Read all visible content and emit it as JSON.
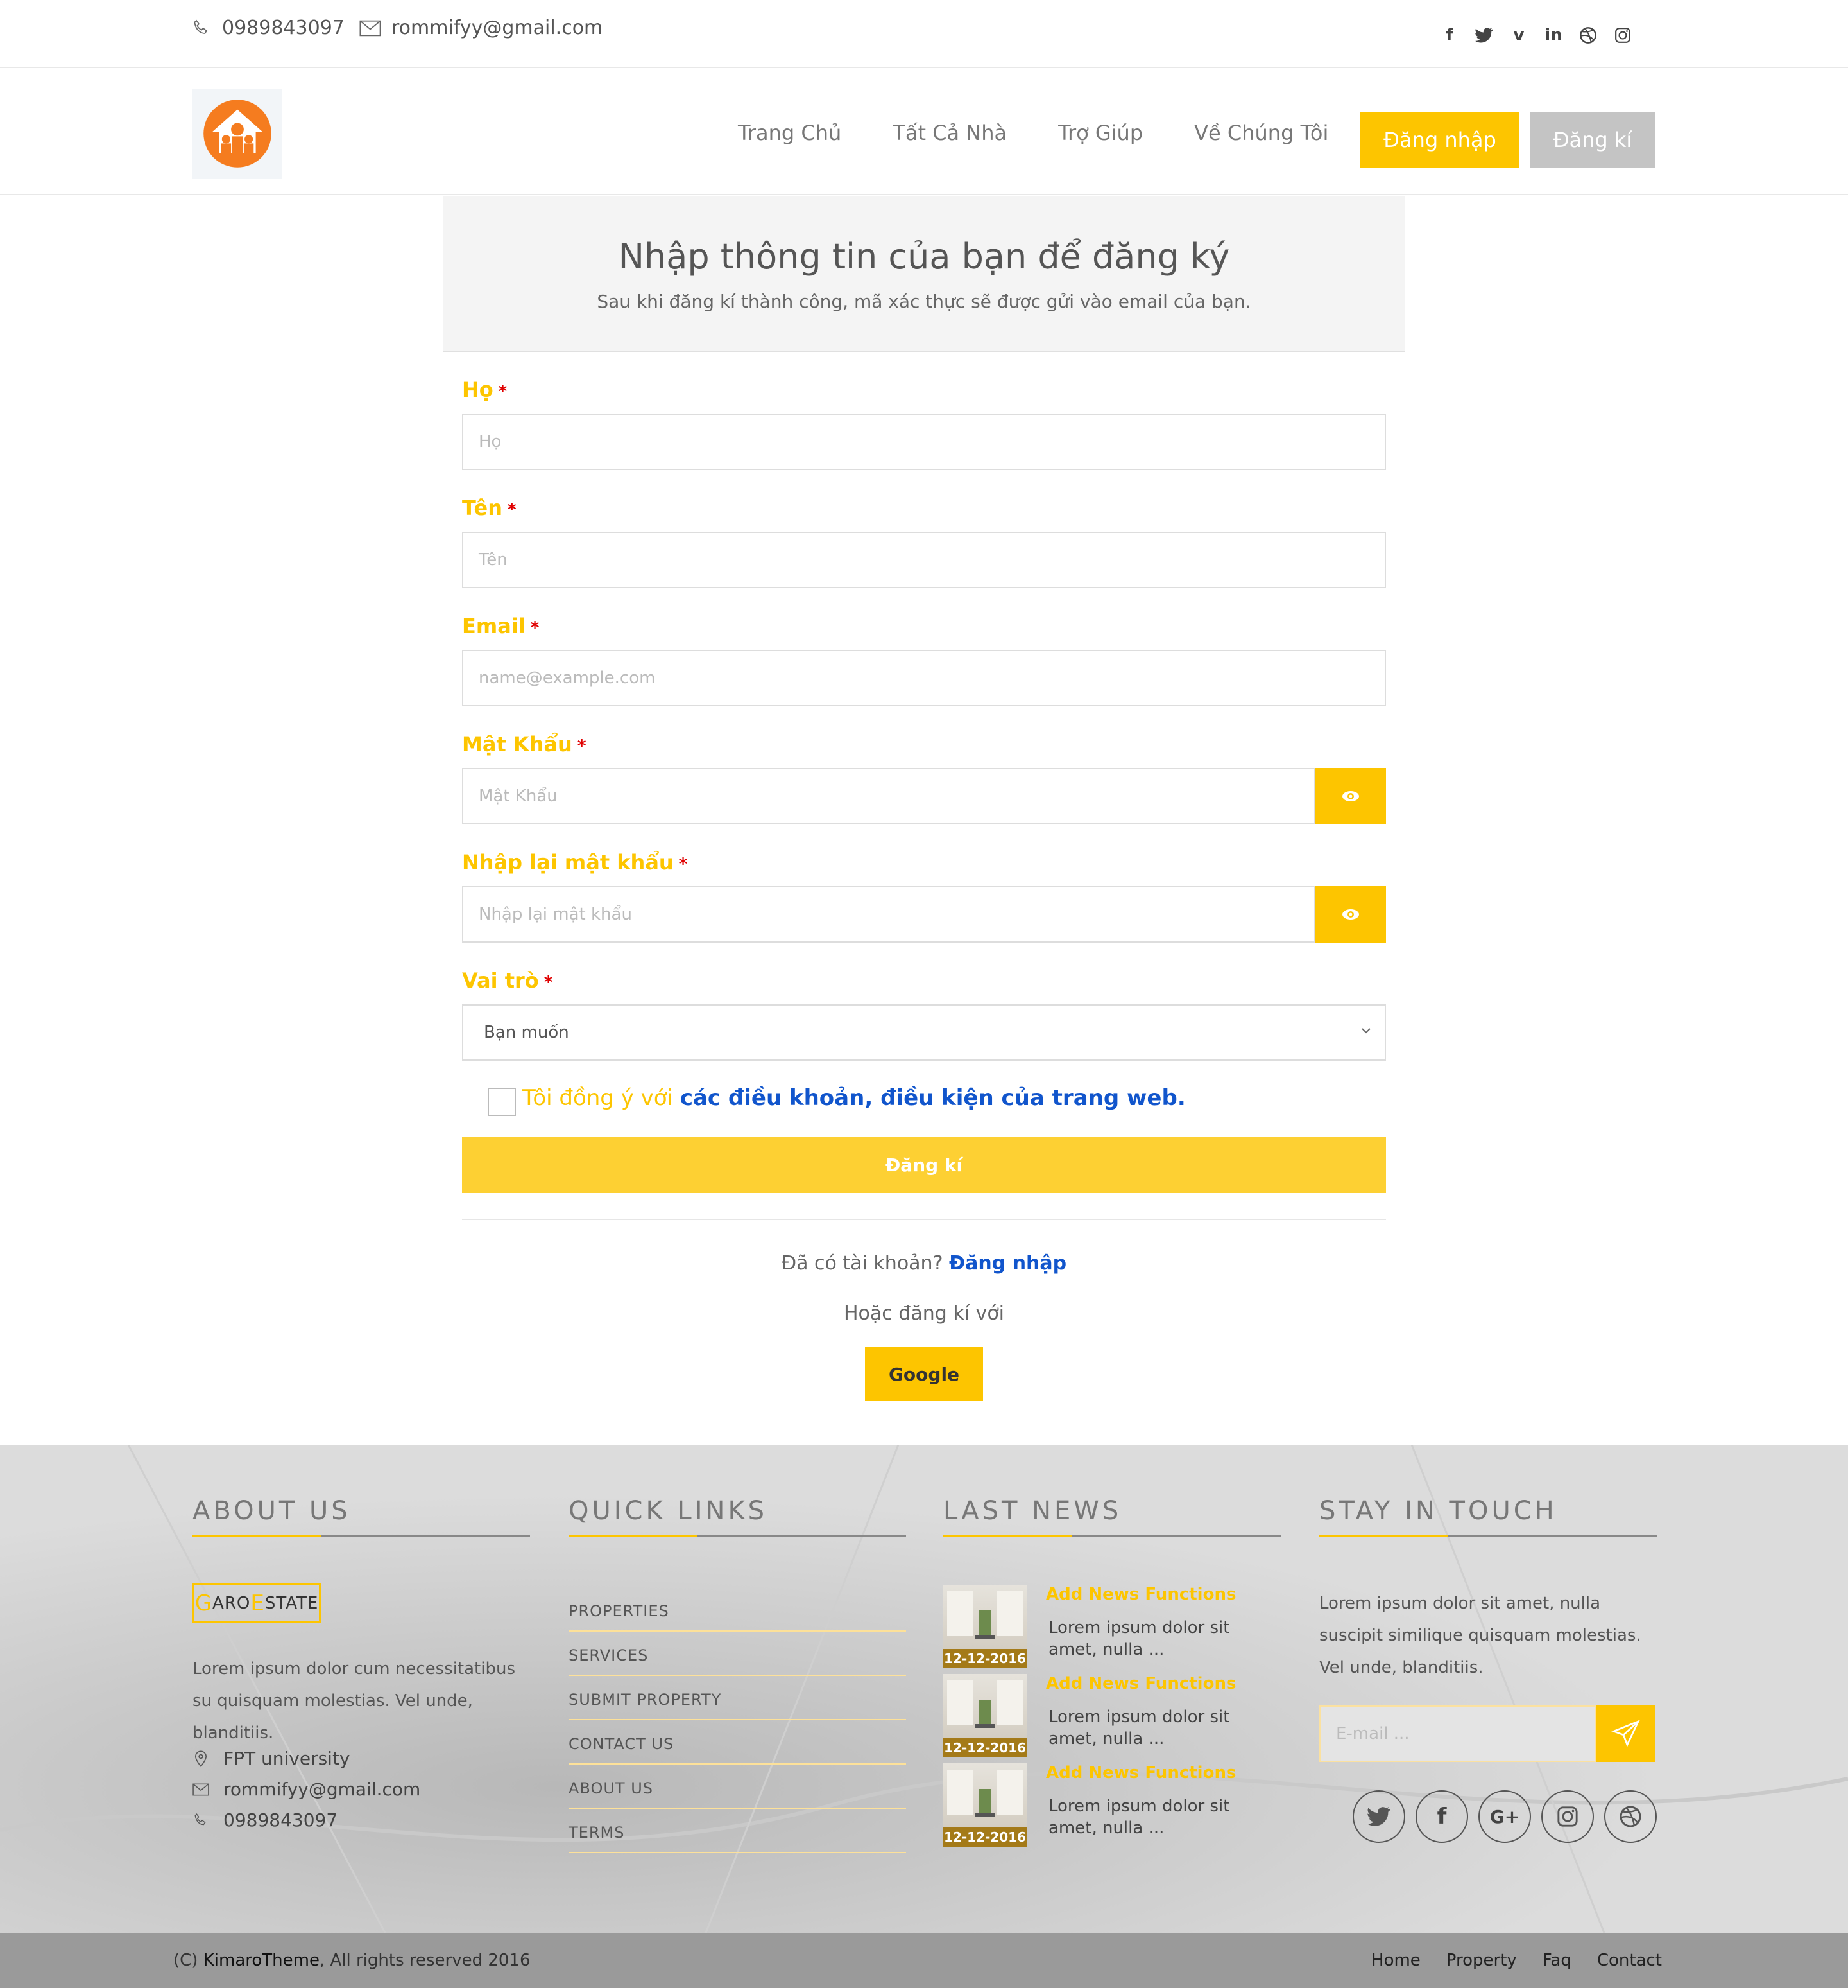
{
  "topbar": {
    "phone": "0989843097",
    "email": "rommifyy@gmail.com",
    "social_icons": [
      "facebook-icon",
      "twitter-icon",
      "vine-icon",
      "linkedin-icon",
      "dribbble-icon",
      "instagram-icon"
    ]
  },
  "nav": {
    "links": [
      "Trang Chủ",
      "Tất Cả Nhà",
      "Trợ Giúp",
      "Về Chúng Tôi"
    ],
    "login": "Đăng nhập",
    "register": "Đăng kí",
    "accent": "#fdc500"
  },
  "form": {
    "title": "Nhập thông tin của bạn để đăng ký",
    "subtitle": "Sau khi đăng kí thành công, mã xác thực sẽ được gửi vào email của bạn.",
    "fields": [
      {
        "label": "Họ",
        "placeholder": "Họ"
      },
      {
        "label": "Tên",
        "placeholder": "Tên"
      },
      {
        "label": "Email",
        "placeholder": "name@example.com"
      },
      {
        "label": "Mật Khẩu",
        "placeholder": "Mật Khẩu"
      },
      {
        "label": "Nhập lại mật khẩu",
        "placeholder": "Nhập lại mật khẩu"
      },
      {
        "label": "Vai trò",
        "placeholder": "Bạn muốn"
      }
    ],
    "required_mark": "*",
    "agree_prefix": "Tôi đồng ý với",
    "agree_link": "các điều khoản, điều kiện của trang web.",
    "submit": "Đăng kí",
    "have_account": "Đã có tài khoản?",
    "login_link": "Đăng nhập",
    "or_text": "Hoặc đăng kí với",
    "google": "Google"
  },
  "footer": {
    "about": {
      "title": "ABOUT US",
      "logo_first": "G",
      "logo_mid": "ARO ",
      "logo_e": "E",
      "logo_rest": "STATE",
      "text": "Lorem ipsum dolor cum necessitatibus su quisquam molestias. Vel unde, blanditiis.",
      "address": "FPT university",
      "email": "rommifyy@gmail.com",
      "phone": "0989843097"
    },
    "quick_links": {
      "title": "QUICK LINKS",
      "items": [
        "PROPERTIES",
        "SERVICES",
        "SUBMIT PROPERTY",
        "CONTACT US",
        "ABOUT US",
        "TERMS"
      ]
    },
    "news": {
      "title": "LAST NEWS",
      "items": [
        {
          "title": "Add News Functions",
          "text": "Lorem ipsum dolor sit amet, nulla ...",
          "date": "12-12-2016"
        },
        {
          "title": "Add News Functions",
          "text": "Lorem ipsum dolor sit amet, nulla ...",
          "date": "12-12-2016"
        },
        {
          "title": "Add News Functions",
          "text": "Lorem ipsum dolor sit amet, nulla ...",
          "date": "12-12-2016"
        }
      ]
    },
    "stay": {
      "title": "STAY IN TOUCH",
      "text": "Lorem ipsum dolor sit amet, nulla suscipit similique quisquam molestias. Vel unde, blanditiis.",
      "email_placeholder": "E-mail ...",
      "social_icons": [
        "twitter-icon",
        "facebook-icon",
        "google-plus-icon",
        "instagram-icon",
        "dribbble-icon"
      ]
    }
  },
  "copyright": {
    "prefix": "(C)",
    "brand": "KimaroTheme",
    "suffix": ", All rights reserved 2016",
    "links": [
      "Home",
      "Property",
      "Faq",
      "Contact"
    ]
  }
}
